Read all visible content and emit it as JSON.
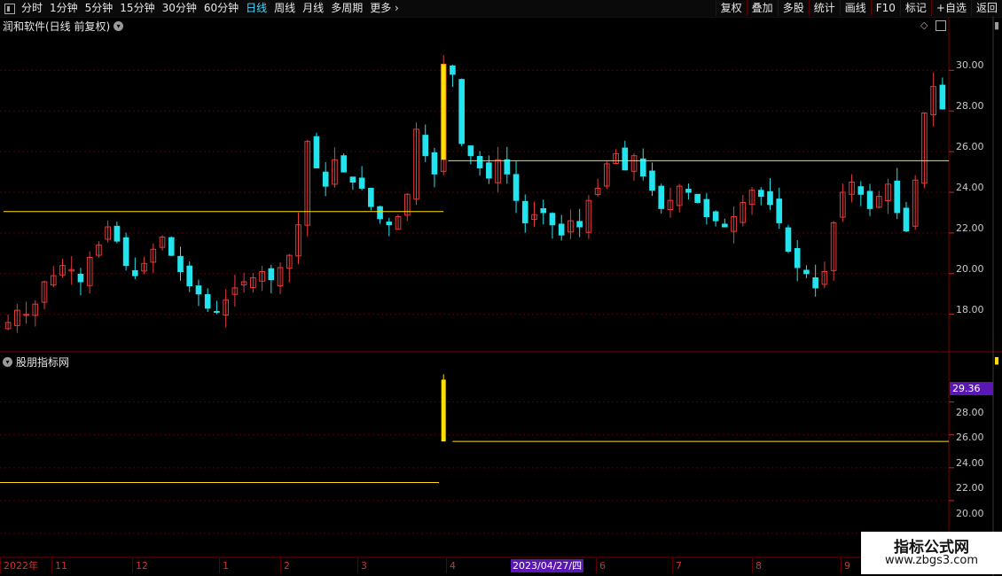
{
  "toolbar": {
    "periods": [
      "分时",
      "1分钟",
      "5分钟",
      "15分钟",
      "30分钟",
      "60分钟",
      "日线",
      "周线",
      "月线",
      "多周期",
      "更多"
    ],
    "active_period": "日线",
    "actions": [
      "复权",
      "叠加",
      "多股",
      "统计",
      "画线",
      "F10",
      "标记",
      "+自选",
      "返回"
    ]
  },
  "main_panel": {
    "title": "润和软件(日线 前复权)",
    "y_ticks": [
      "30.00",
      "28.00",
      "26.00",
      "24.00",
      "22.00",
      "20.00",
      "18.00"
    ]
  },
  "indicator_panel": {
    "title": "股朋指标网",
    "y_ticks": [
      "28.00",
      "26.00",
      "24.00",
      "22.00",
      "20.00"
    ],
    "current_price": "29.36"
  },
  "x_axis": {
    "labels": [
      "2022年",
      "11",
      "12",
      "1",
      "2",
      "3",
      "4",
      "6",
      "7",
      "8",
      "9"
    ],
    "highlight_date": "2023/04/27/四"
  },
  "watermark": {
    "title": "指标公式网",
    "url": "www.zbgs3.com"
  },
  "colors": {
    "up": "#e83a3a",
    "down": "#22e3ee",
    "support_line": "#ffe000",
    "axis_red": "#7a0000",
    "highlight": "#5a17b5"
  },
  "chart_data": {
    "type": "candlestick",
    "ylim": [
      16.2,
      31.8
    ],
    "x": [
      "2022-10",
      "2022-11",
      "2022-12",
      "2023-01",
      "2023-02",
      "2023-03",
      "2023-04",
      "2023-05",
      "2023-06",
      "2023-07",
      "2023-08",
      "2023-09"
    ],
    "close_series": [
      17.6,
      18.2,
      18.0,
      18.5,
      19.6,
      19.9,
      20.4,
      20.2,
      19.6,
      20.8,
      21.4,
      22.3,
      21.6,
      20.4,
      19.9,
      20.5,
      21.2,
      21.8,
      20.9,
      20.1,
      19.4,
      19.0,
      18.3,
      18.1,
      18.7,
      19.3,
      19.6,
      19.8,
      20.1,
      19.7,
      20.3,
      20.9,
      22.4,
      26.5,
      25.2,
      24.3,
      25.6,
      25.0,
      24.5,
      24.2,
      23.3,
      22.7,
      22.4,
      22.8,
      23.9,
      27.1,
      25.8,
      24.9,
      30.3,
      29.8,
      26.4,
      25.8,
      25.2,
      24.7,
      25.6,
      24.9,
      23.6,
      22.5,
      22.9,
      23.0,
      22.4,
      21.9,
      22.6,
      22.3,
      23.6,
      24.2,
      25.4,
      25.9,
      25.1,
      25.8,
      24.8,
      24.1,
      23.2,
      23.6,
      24.3,
      24.0,
      23.5,
      22.8,
      22.6,
      22.3,
      22.8,
      23.5,
      24.1,
      23.8,
      23.4,
      22.5,
      21.1,
      20.3,
      20.0,
      19.3,
      20.1,
      22.5,
      24.0,
      24.5,
      23.9,
      23.2,
      23.8,
      24.4,
      23.0,
      22.1,
      24.6,
      27.9,
      29.2,
      28.1
    ],
    "support_lines": [
      {
        "value": 23.05,
        "x_from": 0,
        "x_to": 48
      },
      {
        "value": 25.55,
        "x_from": 49,
        "x_to": 103
      }
    ],
    "indicator": {
      "lines": [
        {
          "value": 23.1,
          "x_from": 0,
          "x_to": 48
        },
        {
          "value": 25.6,
          "x_from": 49,
          "x_to": 103
        }
      ],
      "spike": {
        "x": 48,
        "from": 25.6,
        "to": 29.36
      },
      "ylim": [
        18.6,
        31.0
      ]
    }
  }
}
